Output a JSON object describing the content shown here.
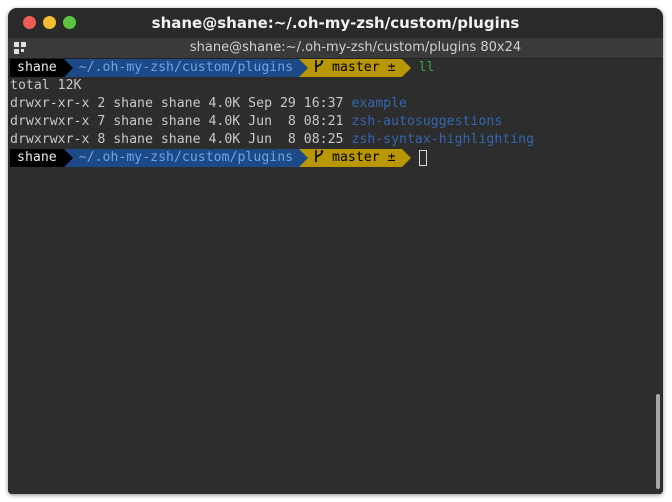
{
  "window": {
    "title": "shane@shane:~/.oh-my-zsh/custom/plugins",
    "tab_title": "shane@shane:~/.oh-my-zsh/custom/plugins 80x24"
  },
  "prompt": {
    "user": "shane",
    "path": "~/.oh-my-zsh/custom/plugins",
    "branch_icon": "git-branch-icon",
    "branch": "master ±"
  },
  "terminal": {
    "command": "ll",
    "total": "total 12K",
    "listing": [
      {
        "meta": "drwxr-xr-x 2 shane shane 4.0K Sep 29 16:37 ",
        "name": "example"
      },
      {
        "meta": "drwxrwxr-x 7 shane shane 4.0K Jun  8 08:21 ",
        "name": "zsh-autosuggestions"
      },
      {
        "meta": "drwxrwxr-x 8 shane shane 4.0K Jun  8 08:25 ",
        "name": "zsh-syntax-highlighting"
      }
    ]
  },
  "colors": {
    "prompt_user_bg": "#000000",
    "prompt_dir_bg": "#1d4a86",
    "prompt_dir_fg": "#6da4e8",
    "prompt_git_bg": "#b99703",
    "command_fg": "#3ba84a",
    "dir_listing_fg": "#3565b0",
    "terminal_bg": "#2d2d2d"
  }
}
